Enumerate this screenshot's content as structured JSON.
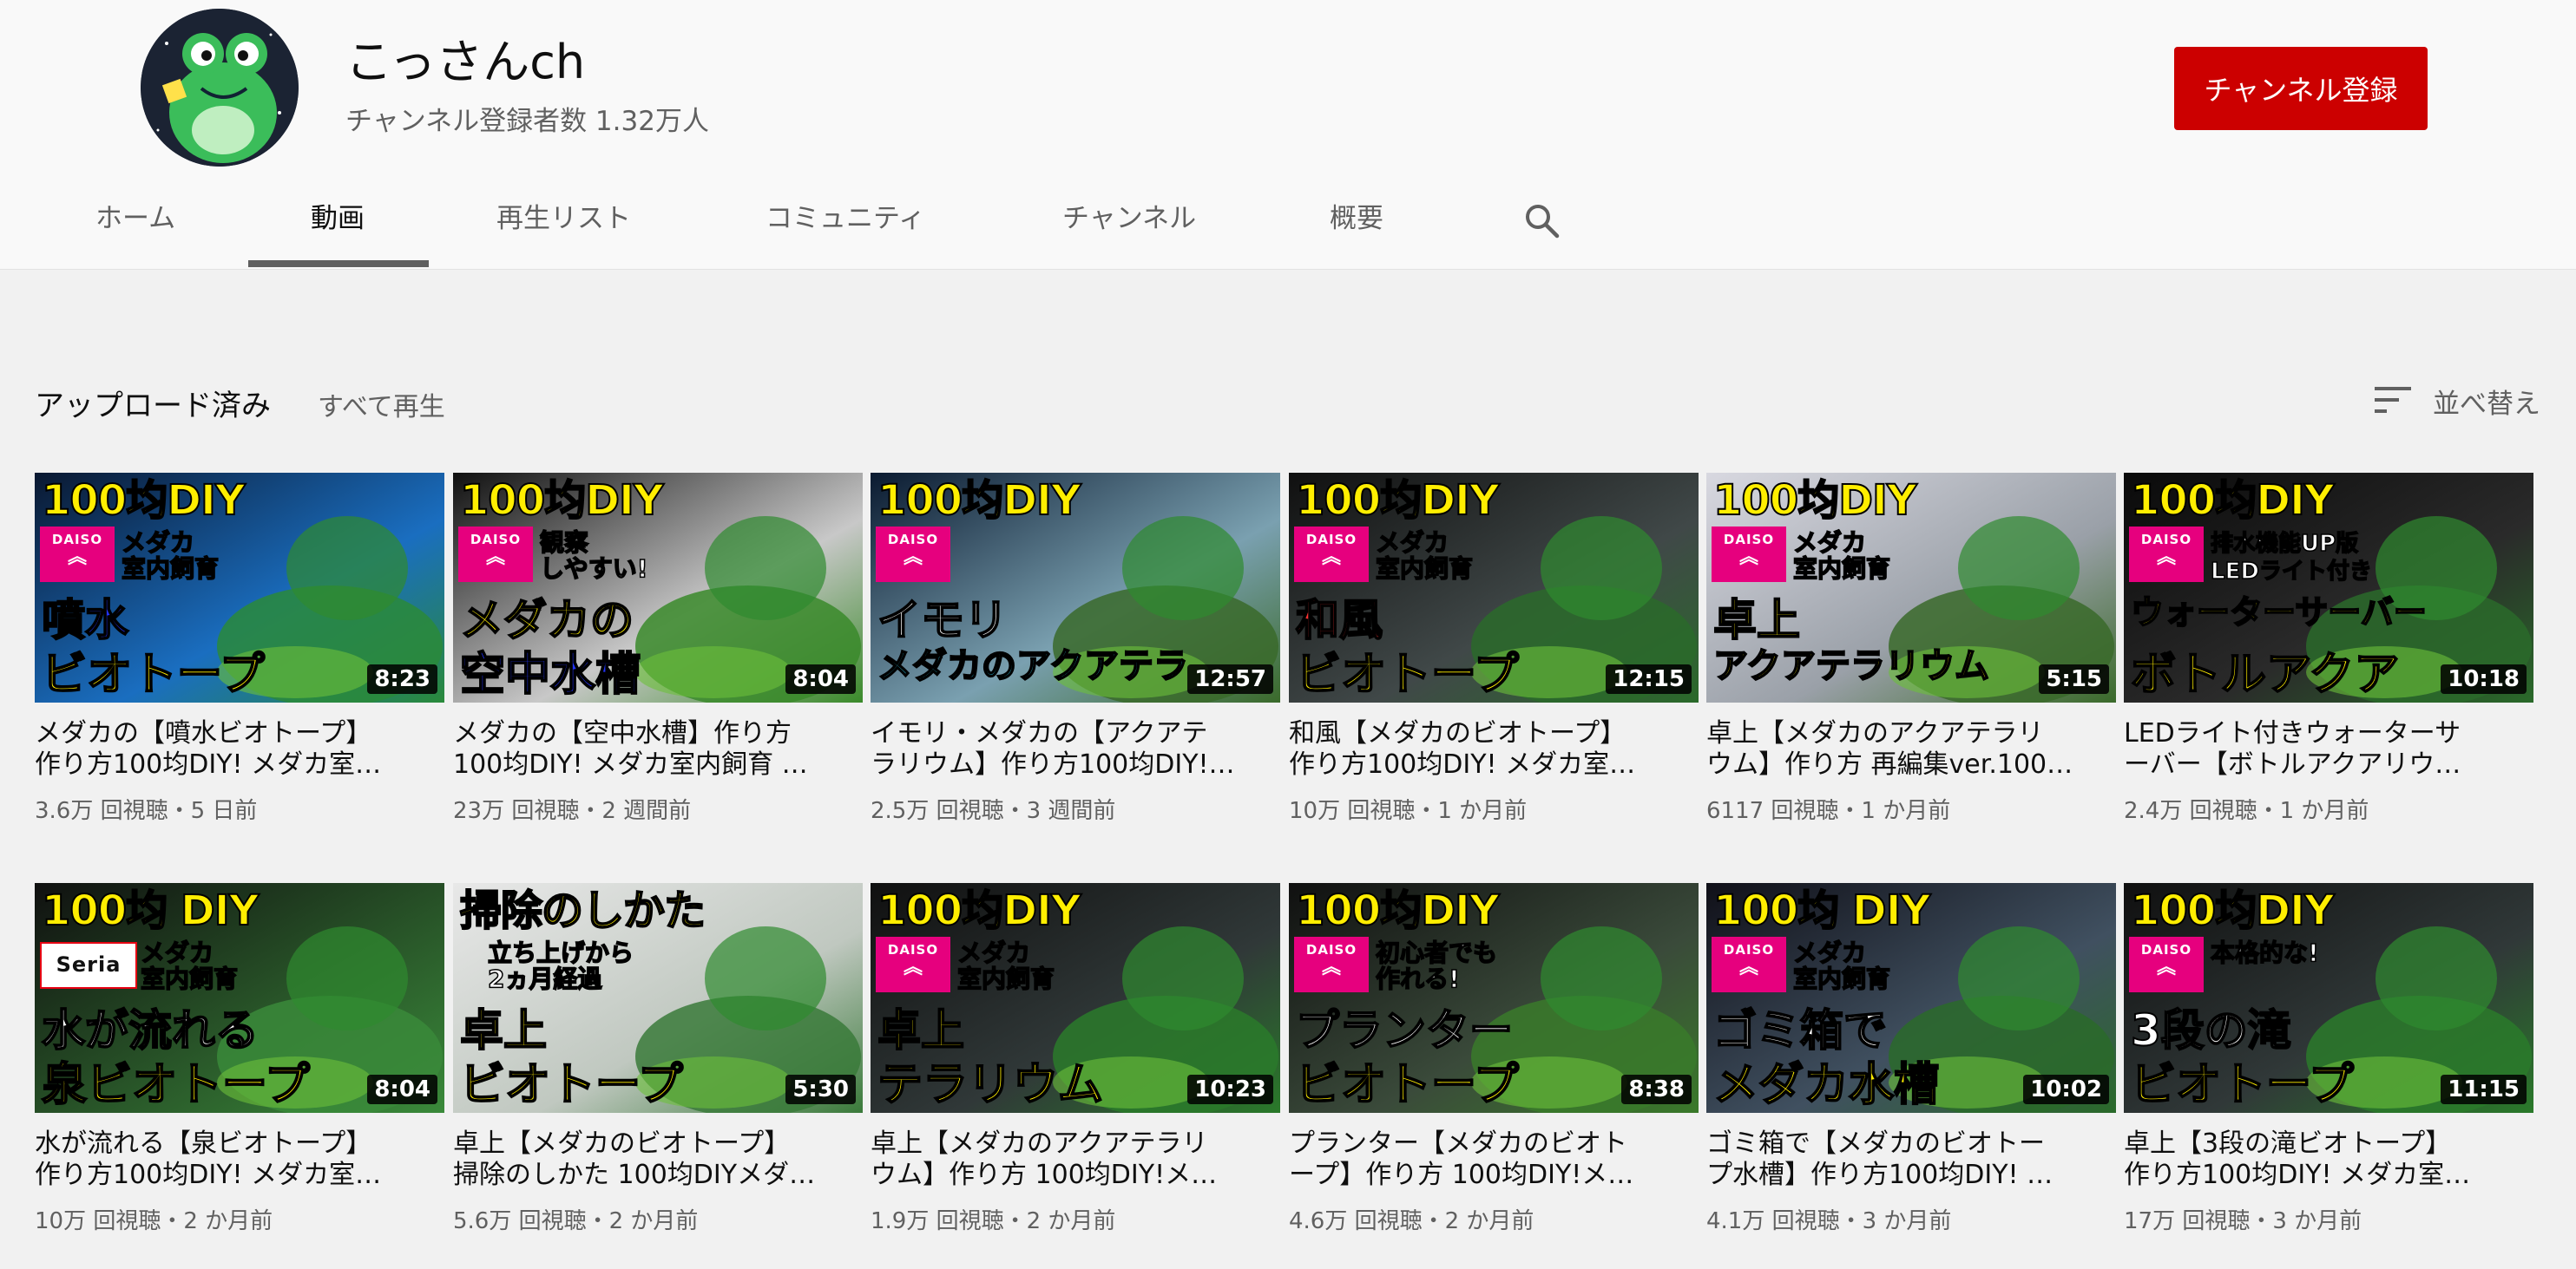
{
  "channel": {
    "name": "こっさんch",
    "subscribers": "チャンネル登録者数 1.32万人",
    "subscribe_label": "チャンネル登録"
  },
  "tabs": [
    {
      "label": "ホーム"
    },
    {
      "label": "動画"
    },
    {
      "label": "再生リスト"
    },
    {
      "label": "コミュニティ"
    },
    {
      "label": "チャンネル"
    },
    {
      "label": "概要"
    }
  ],
  "section": {
    "title": "アップロード済み",
    "play_all": "すべて再生",
    "sort_label": "並べ替え"
  },
  "colors": {
    "subscribe": "#cc0000",
    "accent_yellow": "#ffee00",
    "daiso_pink": "#e6007e"
  },
  "videos": [
    {
      "title_line1": "メダカの【噴水ビオトープ】",
      "title_line2": "作り方100均DIY! メダカ室…",
      "meta": "3.6万 回視聴・5 日前",
      "duration": "8:23",
      "thumb": {
        "top": "100均DIY",
        "brand": "DAISO",
        "mid": "メダカ\n室内飼育",
        "bot1": "噴水",
        "bot2": "ビオトープ",
        "bot1_color": "#2233ff",
        "bot2_color": "#ffee00",
        "bg": [
          "#0a1830",
          "#1a6ec0",
          "#2a8a3a"
        ]
      }
    },
    {
      "title_line1": "メダカの【空中水槽】作り方",
      "title_line2": "100均DIY! メダカ室内飼育 …",
      "meta": "23万 回視聴・2 週間前",
      "duration": "8:04",
      "thumb": {
        "top": "100均DIY",
        "brand": "DAISO",
        "mid": "観察\nしやすい!",
        "bot1": "メダカの",
        "bot2": "空中水槽",
        "bot1_color": "#ffee00",
        "bot2_color": "#2233ff",
        "bg": [
          "#101010",
          "#c8c8c8",
          "#3a8a2a"
        ]
      }
    },
    {
      "title_line1": "イモリ・メダカの【アクアテ",
      "title_line2": "ラリウム】作り方100均DIY!…",
      "meta": "2.5万 回視聴・3 週間前",
      "duration": "12:57",
      "thumb": {
        "top": "100均DIY",
        "brand": "DAISO",
        "mid": "",
        "bot1": "イモリ",
        "bot2": "メダカのアクアテラ",
        "bot1_color": "#ffffff",
        "bot2_color": "#33ddff",
        "bg": [
          "#0a1a30",
          "#7aa0b0",
          "#3a6a2a"
        ]
      }
    },
    {
      "title_line1": "和風【メダカのビオトープ】",
      "title_line2": "作り方100均DIY! メダカ室…",
      "meta": "10万 回視聴・1 か月前",
      "duration": "12:15",
      "thumb": {
        "top": "100均DIY",
        "brand": "DAISO",
        "mid": "メダカ\n室内飼育",
        "bot1": "和風",
        "bot2": "ビオトープ",
        "bot1_color": "#ff3333",
        "bot2_color": "#ffee00",
        "bg": [
          "#101010",
          "#404848",
          "#2a6a2a"
        ]
      }
    },
    {
      "title_line1": "卓上【メダカのアクアテラリ",
      "title_line2": "ウム】作り方 再編集ver.100…",
      "meta": "6117 回視聴・1 か月前",
      "duration": "5:15",
      "thumb": {
        "top": "100均DIY",
        "brand": "DAISO",
        "mid": "メダカ\n室内飼育",
        "bot1": "卓上",
        "bot2": "アクアテラリウム",
        "bot1_color": "#ffee00",
        "bot2_color": "#ffee00",
        "bg": [
          "#d8d8e0",
          "#9aa0a8",
          "#3a6a2a"
        ]
      }
    },
    {
      "title_line1": "LEDライト付きウォーターサ",
      "title_line2": "ーバー【ボトルアクアリウ…",
      "meta": "2.4万 回視聴・1 か月前",
      "duration": "10:18",
      "thumb": {
        "top": "100均DIY",
        "brand": "DAISO",
        "mid": "排水機能UP版\nLEDライト付き",
        "bot1": "ウォーターサーバー",
        "bot2": "ボトルアクア",
        "bot1_color": "#ffee00",
        "bot2_color": "#ffee00",
        "bg": [
          "#0a0a0a",
          "#2a2a2a",
          "#2a6a2a"
        ]
      }
    },
    {
      "title_line1": "水が流れる【泉ビオトープ】",
      "title_line2": "作り方100均DIY! メダカ室…",
      "meta": "10万 回視聴・2 か月前",
      "duration": "8:04",
      "thumb": {
        "top": "100均 DIY",
        "brand": "Seria",
        "mid": "メダカ\n室内飼育",
        "bot1": "水が流れる",
        "bot2": "泉ビオトープ",
        "bot1_color": "#ffffff",
        "bot2_color": "#ffee00",
        "bg": [
          "#101010",
          "#2a5a2a",
          "#3a8a3a"
        ]
      }
    },
    {
      "title_line1": "卓上【メダカのビオトープ】",
      "title_line2": "掃除のしかた 100均DIYメダ…",
      "meta": "5.6万 回視聴・2 か月前",
      "duration": "5:30",
      "thumb": {
        "top": "掃除のしかた",
        "brand": "",
        "mid": "立ち上げから\n2ヵ月経過",
        "bot1": "卓上",
        "bot2": "ビオトープ",
        "bot1_color": "#ffee00",
        "bot2_color": "#ffee00",
        "bg": [
          "#e8e8e8",
          "#c0c8c0",
          "#3a7a3a"
        ]
      }
    },
    {
      "title_line1": "卓上【メダカのアクアテラリ",
      "title_line2": "ウム】作り方 100均DIY!メ…",
      "meta": "1.9万 回視聴・2 か月前",
      "duration": "10:23",
      "thumb": {
        "top": "100均DIY",
        "brand": "DAISO",
        "mid": "メダカ\n室内飼育",
        "bot1": "卓上",
        "bot2": "テラリウム",
        "bot1_color": "#ffee00",
        "bot2_color": "#ffee00",
        "bg": [
          "#101010",
          "#303838",
          "#2a7a2a"
        ]
      }
    },
    {
      "title_line1": "プランター【メダカのビオト",
      "title_line2": "ープ】作り方 100均DIY!メ…",
      "meta": "4.6万 回視聴・2 か月前",
      "duration": "8:38",
      "thumb": {
        "top": "100均DIY",
        "brand": "DAISO",
        "mid": "初心者でも\n作れる!",
        "bot1": "プランター",
        "bot2": "ビオトープ",
        "bot1_color": "#ffffff",
        "bot2_color": "#ffee00",
        "bg": [
          "#101010",
          "#3a4a3a",
          "#3a7a2a"
        ]
      }
    },
    {
      "title_line1": "ゴミ箱で【メダカのビオトー",
      "title_line2": "プ水槽】作り方100均DIY! …",
      "meta": "4.1万 回視聴・3 か月前",
      "duration": "10:02",
      "thumb": {
        "top": "100均 DIY",
        "brand": "DAISO",
        "mid": "メダカ\n室内飼育",
        "bot1": "ゴミ箱で",
        "bot2": "メダカ水槽",
        "bot1_color": "#ffffff",
        "bot2_color": "#ffee00",
        "bg": [
          "#101018",
          "#405060",
          "#2a6a2a"
        ]
      }
    },
    {
      "title_line1": "卓上【3段の滝ビオトープ】",
      "title_line2": "作り方100均DIY! メダカ室…",
      "meta": "17万 回視聴・3 か月前",
      "duration": "11:15",
      "thumb": {
        "top": "100均DIY",
        "brand": "DAISO",
        "mid": "本格的な!",
        "bot1": "3段の滝",
        "bot2": "ビオトープ",
        "bot1_color": "#ffffff",
        "bot2_color": "#ffee00",
        "bg": [
          "#101010",
          "#303838",
          "#2a7a2a"
        ]
      }
    }
  ]
}
